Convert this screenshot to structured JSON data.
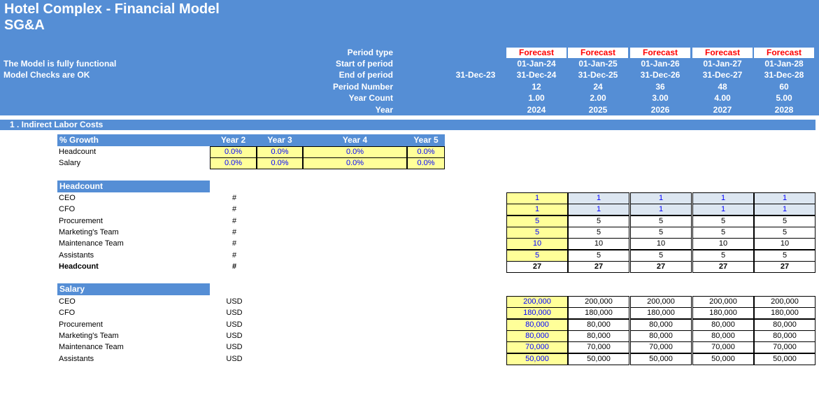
{
  "header": {
    "title": "Hotel Complex - Financial Model",
    "subtitle": "SG&A",
    "status_lines": [
      "The Model is fully functional",
      "Model Checks are OK"
    ],
    "period_labels": [
      "Period type",
      "Start of period",
      "End of period",
      "Period Number",
      "Year Count",
      "Year"
    ],
    "pre_period_end": "31-Dec-23",
    "periods": [
      {
        "type": "Forecast",
        "start": "01-Jan-24",
        "end": "31-Dec-24",
        "number": "12",
        "count": "1.00",
        "year": "2024"
      },
      {
        "type": "Forecast",
        "start": "01-Jan-25",
        "end": "31-Dec-25",
        "number": "24",
        "count": "2.00",
        "year": "2025"
      },
      {
        "type": "Forecast",
        "start": "01-Jan-26",
        "end": "31-Dec-26",
        "number": "36",
        "count": "3.00",
        "year": "2026"
      },
      {
        "type": "Forecast",
        "start": "01-Jan-27",
        "end": "31-Dec-27",
        "number": "48",
        "count": "4.00",
        "year": "2027"
      },
      {
        "type": "Forecast",
        "start": "01-Jan-28",
        "end": "31-Dec-28",
        "number": "60",
        "count": "5.00",
        "year": "2028"
      }
    ]
  },
  "section": "1 . Indirect Labor Costs",
  "growth": {
    "header": "% Growth",
    "columns": [
      "Year 2",
      "Year 3",
      "Year 4",
      "Year 5"
    ],
    "rows": [
      {
        "label": "Headcount",
        "values": [
          "0.0%",
          "0.0%",
          "0.0%",
          "0.0%"
        ]
      },
      {
        "label": "Salary",
        "values": [
          "0.0%",
          "0.0%",
          "0.0%",
          "0.0%"
        ]
      }
    ]
  },
  "headcount": {
    "header": "Headcount",
    "rows": [
      {
        "label": "CEO",
        "unit": "#",
        "values": [
          "1",
          "1",
          "1",
          "1",
          "1"
        ]
      },
      {
        "label": "CFO",
        "unit": "#",
        "values": [
          "1",
          "1",
          "1",
          "1",
          "1"
        ]
      },
      {
        "label": "Procurement",
        "unit": "#",
        "values": [
          "5",
          "5",
          "5",
          "5",
          "5"
        ]
      },
      {
        "label": "Marketing's Team",
        "unit": "#",
        "values": [
          "5",
          "5",
          "5",
          "5",
          "5"
        ]
      },
      {
        "label": "Maintenance Team",
        "unit": "#",
        "values": [
          "10",
          "10",
          "10",
          "10",
          "10"
        ]
      },
      {
        "label": "Assistants",
        "unit": "#",
        "values": [
          "5",
          "5",
          "5",
          "5",
          "5"
        ]
      },
      {
        "label": "Headcount",
        "unit": "#",
        "values": [
          "27",
          "27",
          "27",
          "27",
          "27"
        ]
      }
    ]
  },
  "salary": {
    "header": "Salary",
    "rows": [
      {
        "label": "CEO",
        "unit": "USD",
        "values": [
          "200,000",
          "200,000",
          "200,000",
          "200,000",
          "200,000"
        ]
      },
      {
        "label": "CFO",
        "unit": "USD",
        "values": [
          "180,000",
          "180,000",
          "180,000",
          "180,000",
          "180,000"
        ]
      },
      {
        "label": "Procurement",
        "unit": "USD",
        "values": [
          "80,000",
          "80,000",
          "80,000",
          "80,000",
          "80,000"
        ]
      },
      {
        "label": "Marketing's Team",
        "unit": "USD",
        "values": [
          "80,000",
          "80,000",
          "80,000",
          "80,000",
          "80,000"
        ]
      },
      {
        "label": "Maintenance Team",
        "unit": "USD",
        "values": [
          "70,000",
          "70,000",
          "70,000",
          "70,000",
          "70,000"
        ]
      },
      {
        "label": "Assistants",
        "unit": "USD",
        "values": [
          "50,000",
          "50,000",
          "50,000",
          "50,000",
          "50,000"
        ]
      }
    ]
  },
  "colors": {
    "header_bg": "#558ed5",
    "input_yellow": "#ffff99",
    "input_blue": "#dce6f1",
    "forecast_red": "#ff0000",
    "input_text": "#0000ff"
  }
}
